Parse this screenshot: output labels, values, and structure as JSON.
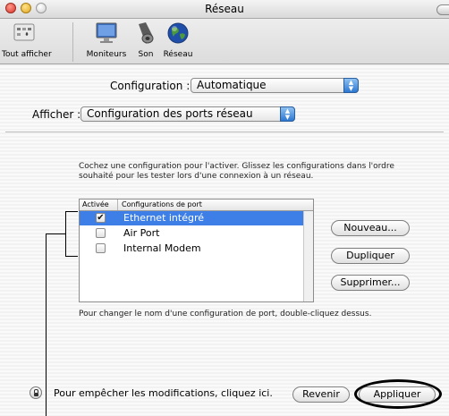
{
  "window": {
    "title": "Réseau"
  },
  "toolbar": {
    "items": [
      {
        "label": "Tout afficher",
        "icon": "show-all-icon"
      },
      {
        "label": "Moniteurs",
        "icon": "monitor-icon"
      },
      {
        "label": "Son",
        "icon": "speaker-icon"
      },
      {
        "label": "Réseau",
        "icon": "globe-icon"
      }
    ]
  },
  "configuration": {
    "label": "Configuration :",
    "value": "Automatique"
  },
  "show": {
    "label": "Afficher :",
    "value": "Configuration des ports réseau"
  },
  "description": "Cochez une configuration pour l'activer. Glissez les configurations dans l'ordre souhaité pour les tester lors d'une connexion à un réseau.",
  "table": {
    "headers": [
      "Activée",
      "Configurations de port"
    ],
    "rows": [
      {
        "checked": true,
        "check_mark": "✔",
        "name": "Ethernet intégré",
        "selected": true
      },
      {
        "checked": false,
        "check_mark": "",
        "name": "Air Port",
        "selected": false
      },
      {
        "checked": false,
        "check_mark": "",
        "name": "Internal  Modem",
        "selected": false
      }
    ]
  },
  "side_buttons": {
    "new": "Nouveau...",
    "duplicate": "Dupliquer",
    "delete": "Supprimer..."
  },
  "hint": "Pour changer le nom d'une configuration de port, double-cliquez dessus.",
  "footer": {
    "lock_text": "Pour empêcher les modifications, cliquez ici.",
    "revert": "Revenir",
    "apply": "Appliquer"
  },
  "colors": {
    "selection": "#3d7fe6",
    "popup_arrow": "#2c78d2"
  }
}
